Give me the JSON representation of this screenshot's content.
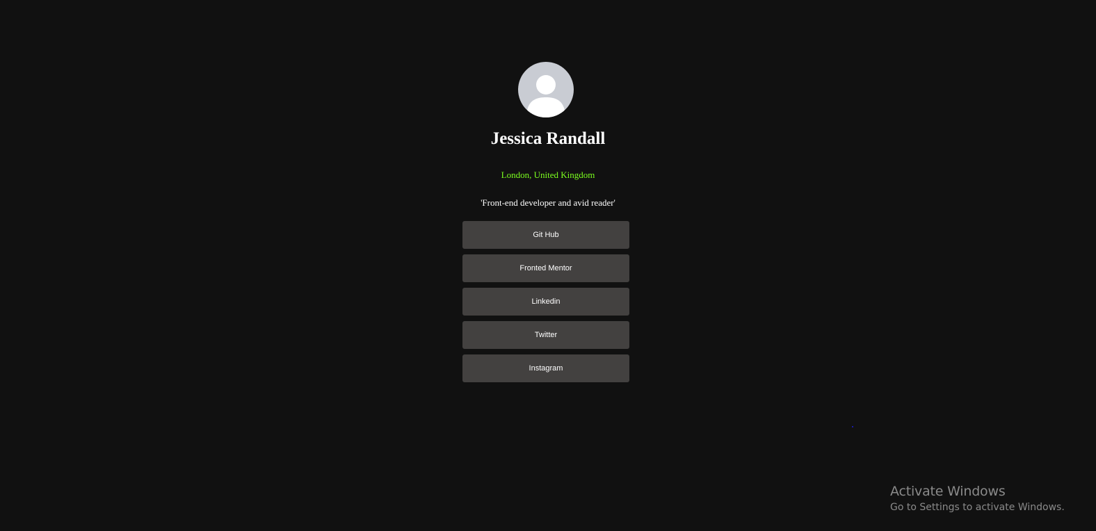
{
  "profile": {
    "name": "Jessica Randall",
    "location": "London, United Kingdom",
    "bio": "'Front-end developer and avid reader'",
    "avatar_icon": "user-silhouette-icon"
  },
  "links": [
    {
      "label": "Git Hub"
    },
    {
      "label": "Fronted Mentor"
    },
    {
      "label": "Linkedin"
    },
    {
      "label": "Twitter"
    },
    {
      "label": "Instagram"
    }
  ],
  "watermark": {
    "title": "Activate Windows",
    "subtitle": "Go to Settings to activate Windows."
  },
  "colors": {
    "background": "#111111",
    "button": "#434140",
    "location_text": "#7cff1f",
    "avatar_bg": "#c9ccd3"
  }
}
